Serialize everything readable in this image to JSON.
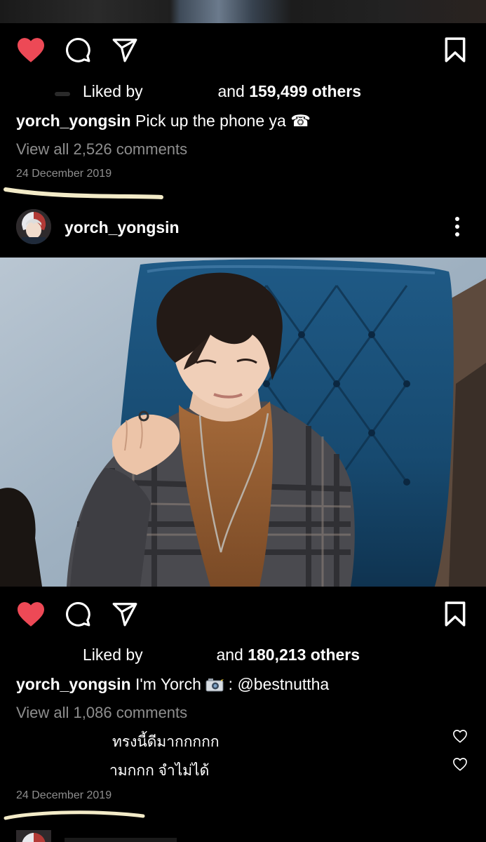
{
  "post1": {
    "liked_prefix": "Liked by",
    "liked_connector": "and",
    "liked_count": "159,499 others",
    "caption_username": "yorch_yongsin",
    "caption_text": "Pick up the phone ya ☎",
    "view_all": "View all 2,526 comments",
    "date": "24 December 2019"
  },
  "post2": {
    "header_username": "yorch_yongsin",
    "liked_prefix": "Liked by",
    "liked_connector": "and",
    "liked_count": "180,213 others",
    "caption_username": "yorch_yongsin",
    "caption_text_pre": "I'm Yorch",
    "caption_text_post": ": @bestnuttha",
    "view_all": "View all 1,086 comments",
    "comments": [
      {
        "text": "ทรงนี้ดีมากกกกก"
      },
      {
        "text": "ามกกก จำไม่ได้"
      }
    ],
    "date": "24 December 2019"
  },
  "icons": {
    "like": "heart-filled-icon",
    "comment": "comment-bubble-icon",
    "share": "paper-plane-icon",
    "save": "bookmark-icon",
    "more": "more-vertical-icon",
    "comment_like": "heart-outline-icon"
  },
  "colors": {
    "background": "#000000",
    "like_red": "#ED4956",
    "secondary_text": "#8E8E8E",
    "highlight_stroke": "#F3EBC8"
  }
}
